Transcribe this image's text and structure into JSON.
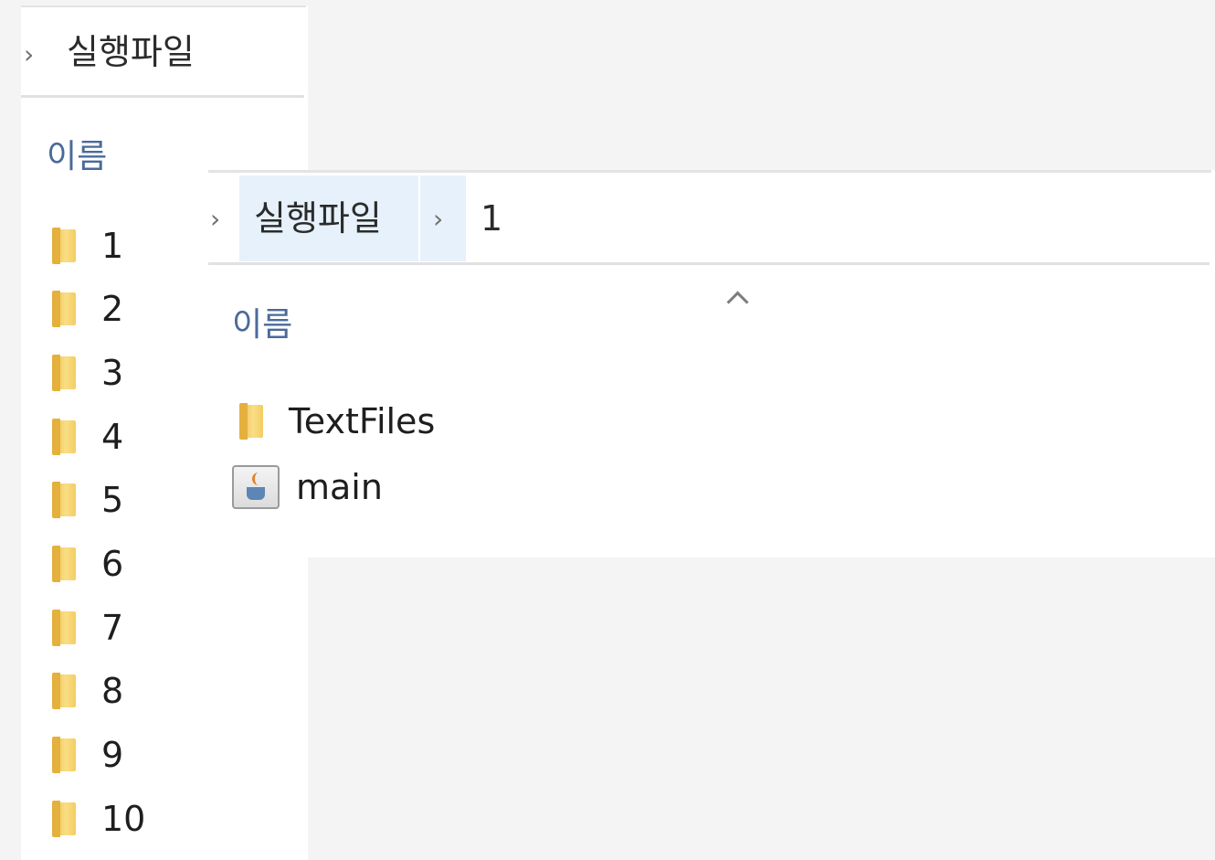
{
  "back_window": {
    "breadcrumb": [
      "실행파일"
    ],
    "column_header": "이름",
    "items": [
      {
        "label": "1",
        "icon": "folder-icon"
      },
      {
        "label": "2",
        "icon": "folder-icon"
      },
      {
        "label": "3",
        "icon": "folder-icon"
      },
      {
        "label": "4",
        "icon": "folder-icon"
      },
      {
        "label": "5",
        "icon": "folder-icon"
      },
      {
        "label": "6",
        "icon": "folder-icon"
      },
      {
        "label": "7",
        "icon": "folder-icon"
      },
      {
        "label": "8",
        "icon": "folder-icon"
      },
      {
        "label": "9",
        "icon": "folder-icon"
      },
      {
        "label": "10",
        "icon": "folder-icon"
      }
    ]
  },
  "front_window": {
    "breadcrumb": [
      "실행파일",
      "1"
    ],
    "column_header": "이름",
    "items": [
      {
        "label": "TextFiles",
        "icon": "folder-icon"
      },
      {
        "label": "main",
        "icon": "java-file-icon"
      }
    ]
  },
  "colors": {
    "background": "#f4f4f4",
    "panel": "#ffffff",
    "breadcrumb_highlight": "#e6f1fb",
    "column_header": "#4a6a9a",
    "folder": "#f3cd62"
  }
}
